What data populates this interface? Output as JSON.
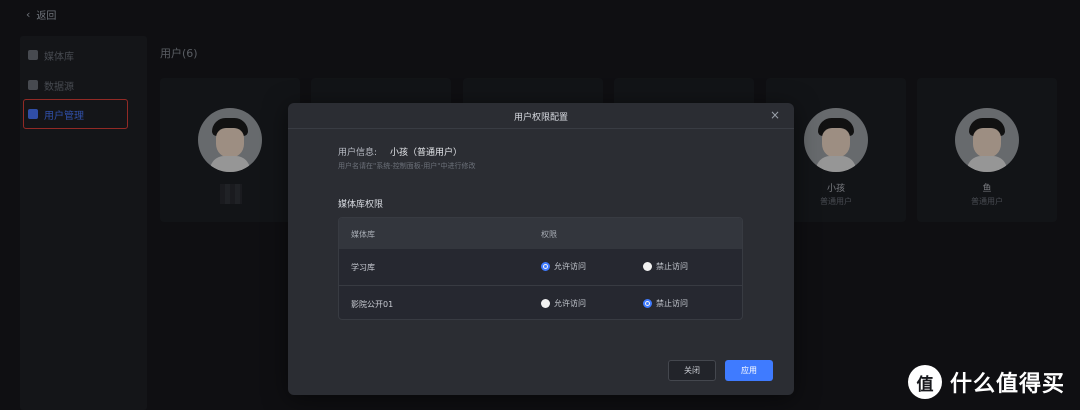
{
  "topbar": {
    "back_label": "返回"
  },
  "sidebar": {
    "items": [
      {
        "label": "媒体库"
      },
      {
        "label": "数据源"
      },
      {
        "label": "用户管理"
      }
    ]
  },
  "main": {
    "title": "用户(6)",
    "cards": [
      {
        "name": "",
        "role": ""
      },
      {
        "name": "",
        "role": ""
      },
      {
        "name": "",
        "role": ""
      },
      {
        "name": "",
        "role": ""
      },
      {
        "name": "小孩",
        "role": "普通用户"
      },
      {
        "name": "鱼",
        "role": "普通用户"
      }
    ]
  },
  "dialog": {
    "title": "用户权限配置",
    "close_icon": "×",
    "info_label": "用户信息:",
    "info_value": "小孩（普通用户）",
    "info_hint": "用户名请在\"系统-控制面板-用户\"中进行修改",
    "section_title": "媒体库权限",
    "table": {
      "col_library": "媒体库",
      "col_permission": "权限",
      "rows": [
        {
          "library": "学习库",
          "allow": "允许访问",
          "deny": "禁止访问",
          "selected": "allow"
        },
        {
          "library": "影院公开01",
          "allow": "允许访问",
          "deny": "禁止访问",
          "selected": "deny"
        }
      ]
    },
    "cancel_label": "关闭",
    "apply_label": "应用"
  },
  "watermark": {
    "logo": "值",
    "text": "什么值得买"
  },
  "colors": {
    "accent": "#3f7bff",
    "highlight": "#e0413a",
    "background": "#17181c"
  }
}
